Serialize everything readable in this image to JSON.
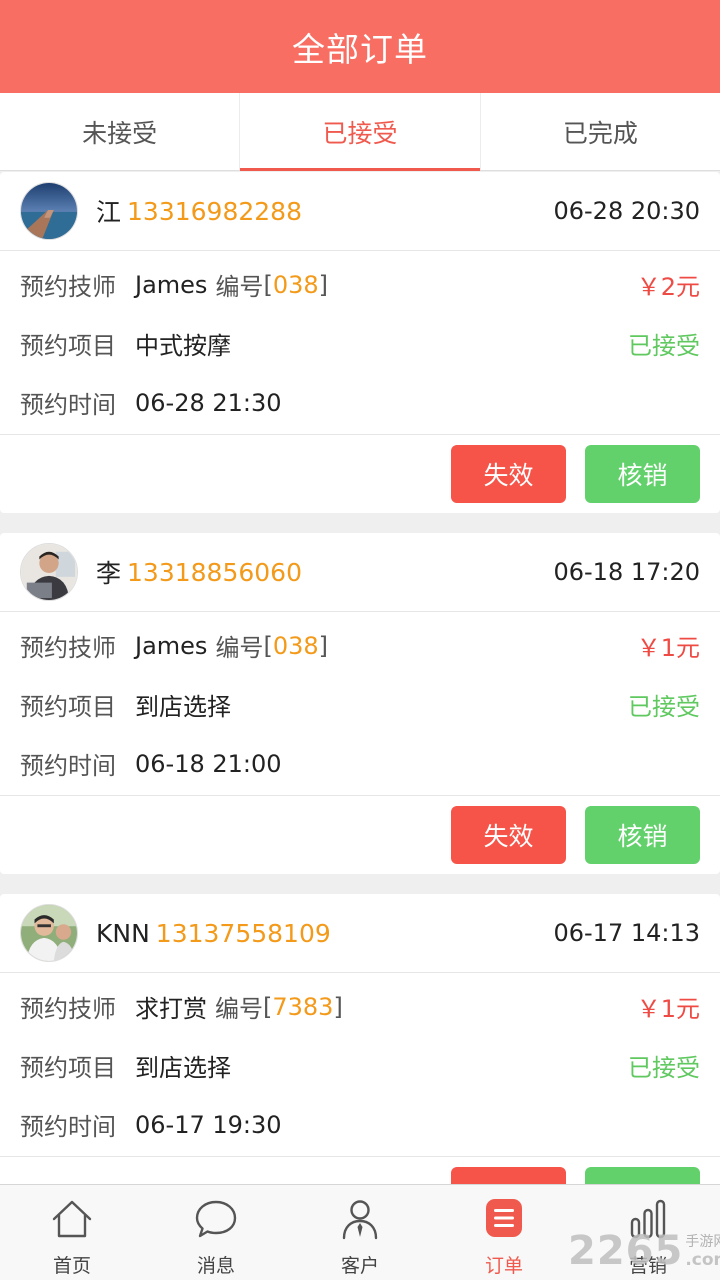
{
  "header": {
    "title": "全部订单"
  },
  "tabs": [
    {
      "label": "未接受",
      "active": false
    },
    {
      "label": "已接受",
      "active": true
    },
    {
      "label": "已完成",
      "active": false
    }
  ],
  "labels": {
    "technician": "预约技师",
    "item": "预约项目",
    "time": "预约时间",
    "number": "编号",
    "invalid_btn": "失效",
    "verify_btn": "核销"
  },
  "orders": [
    {
      "customer": "江",
      "phone": "13316982288",
      "order_time": "06-28 20:30",
      "technician": "James",
      "tech_code": "038",
      "price": "￥2元",
      "project": "中式按摩",
      "status": "已接受",
      "appointment_time": "06-28 21:30"
    },
    {
      "customer": "李",
      "phone": "13318856060",
      "order_time": "06-18 17:20",
      "technician": "James",
      "tech_code": "038",
      "price": "￥1元",
      "project": "到店选择",
      "status": "已接受",
      "appointment_time": "06-18 21:00"
    },
    {
      "customer": "KNN",
      "phone": "13137558109",
      "order_time": "06-17 14:13",
      "technician": "求打赏",
      "tech_code": "7383",
      "price": "￥1元",
      "project": "到店选择",
      "status": "已接受",
      "appointment_time": "06-17 19:30"
    }
  ],
  "bottom_nav": [
    {
      "label": "首页",
      "icon": "home-icon"
    },
    {
      "label": "消息",
      "icon": "message-icon"
    },
    {
      "label": "客户",
      "icon": "customer-icon"
    },
    {
      "label": "订单",
      "icon": "order-icon",
      "active": true
    },
    {
      "label": "营销",
      "icon": "marketing-icon"
    }
  ],
  "watermark": {
    "number": "2265",
    "text_top": "手游网",
    "text_bottom": ".com"
  },
  "colors": {
    "brand": "#f86e63",
    "accent": "#f05a4e",
    "phone": "#f39a1a",
    "price": "#ef4b45",
    "status": "#5fc85f",
    "invalid_button": "#f65448",
    "verify_button": "#62d16b"
  }
}
